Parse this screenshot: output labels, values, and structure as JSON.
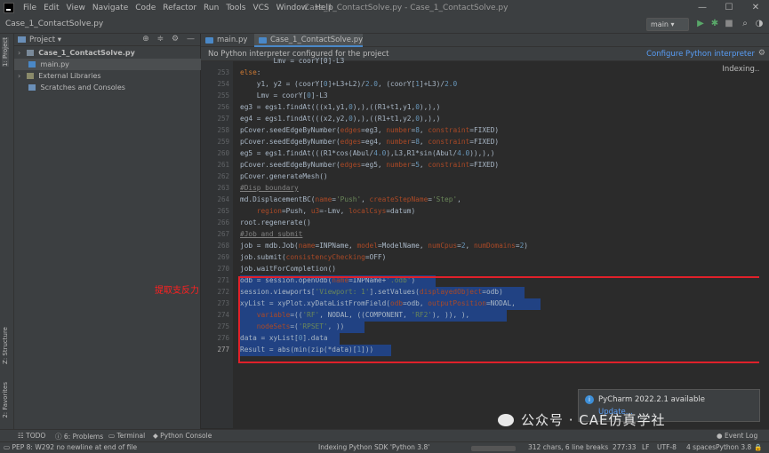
{
  "menubar": {
    "items": [
      "File",
      "Edit",
      "View",
      "Navigate",
      "Code",
      "Refactor",
      "Run",
      "Tools",
      "VCS",
      "Window",
      "Help"
    ],
    "window_title": "Case_1_ContactSolve.py - Case_1_ContactSolve.py",
    "minimize": "—",
    "maximize": "☐",
    "close": "✕"
  },
  "navbar": {
    "breadcrumb": "Case_1_ContactSolve.py",
    "branch": "main ▾"
  },
  "left_stripe": {
    "project_tab": "1: Project",
    "structure_tab": "Z: Structure",
    "favorites_tab": "2: Favorites"
  },
  "project_panel": {
    "title": "Project ▾",
    "tree": [
      {
        "label": "Case_1_ContactSolve.py",
        "bold": true
      },
      {
        "label": "main.py",
        "bold": false
      },
      {
        "label": "External Libraries",
        "bold": false
      },
      {
        "label": "Scratches and Consoles",
        "bold": false
      }
    ]
  },
  "tabs": [
    {
      "label": "main.py",
      "close": "×"
    },
    {
      "label": "Case_1_ContactSolve.py",
      "close": "×"
    }
  ],
  "banner": {
    "text": "No Python interpreter configured for the project",
    "link": "Configure Python interpreter"
  },
  "editor": {
    "indexing": "Indexing...",
    "annotation": "提取支反力",
    "current_line": "277",
    "top_fragment": "        Lmv = coorY[0]-L3",
    "lines": [
      {
        "num": "253",
        "text": "else:"
      },
      {
        "num": "254",
        "text": "    y1, y2 = (coorY[0]+L3+L2)/2.0, (coorY[1]+L3)/2.0"
      },
      {
        "num": "255",
        "text": "    Lmv = coorY[0]-L3"
      },
      {
        "num": "256",
        "text": "eg3 = egs1.findAt(((x1,y1,0),),((R1+t1,y1,0),),)"
      },
      {
        "num": "257",
        "text": "eg4 = egs1.findAt(((x2,y2,0),),((R1+t1,y2,0),),)"
      },
      {
        "num": "258",
        "text": "pCover.seedEdgeByNumber(edges=eg3, number=8, constraint=FIXED)"
      },
      {
        "num": "259",
        "text": "pCover.seedEdgeByNumber(edges=eg4, number=8, constraint=FIXED)"
      },
      {
        "num": "260",
        "text": "eg5 = egs1.findAt(((R1*cos(Abul/4.0),L3,R1*sin(Abul/4.0)),),)"
      },
      {
        "num": "261",
        "text": "pCover.seedEdgeByNumber(edges=eg5, number=5, constraint=FIXED)"
      },
      {
        "num": "262",
        "text": "pCover.generateMesh()"
      },
      {
        "num": "263",
        "text": "#Disp boundary"
      },
      {
        "num": "264",
        "text": "md.DisplacementBC(name='Push', createStepName='Step',"
      },
      {
        "num": "265",
        "text": "    region=Push, u3=-Lmv, localCsys=datum)"
      },
      {
        "num": "266",
        "text": "root.regenerate()"
      },
      {
        "num": "267",
        "text": "#Job and submit"
      },
      {
        "num": "268",
        "text": "job = mdb.Job(name=INPName, model=ModelName, numCpus=2, numDomains=2)"
      },
      {
        "num": "269",
        "text": "job.submit(consistencyChecking=OFF)"
      },
      {
        "num": "270",
        "text": "job.waitForCompletion()"
      },
      {
        "num": "271",
        "text": "odb = session.openOdb(name=INPName+'.odb')"
      },
      {
        "num": "272",
        "text": "session.viewports['Viewport: 1'].setValues(displayedObject=odb)"
      },
      {
        "num": "273",
        "text": "xyList = xyPlot.xyDataListFromField(odb=odb, outputPosition=NODAL,"
      },
      {
        "num": "274",
        "text": "    variable=(('RF', NODAL, ((COMPONENT, 'RF2'), )), ),"
      },
      {
        "num": "275",
        "text": "    nodeSets=('RPSET', ))"
      },
      {
        "num": "276",
        "text": "data = xyList[0].data"
      },
      {
        "num": "277",
        "text": "Result = abs(min(zip(*data)[1]))"
      }
    ]
  },
  "notification": {
    "title": "PyCharm 2022.2.1 available",
    "link": "Update..."
  },
  "watermark": "公众号 · CAE仿真学社",
  "tool_windows": {
    "todo": "TODO",
    "problems": "6: Problems",
    "terminal": "Terminal",
    "python_console": "Python Console",
    "event_log": "Event Log"
  },
  "status": {
    "message": "PEP 8: W292 no newline at end of file",
    "indexing": "Indexing Python SDK 'Python 3.8'",
    "chars": "312 chars, 6 line breaks",
    "position": "277:33",
    "line_sep": "LF",
    "encoding": "UTF-8",
    "indent": "4 spaces",
    "interpreter": "Python 3.8"
  },
  "colors": {
    "accent": "#4a88c7",
    "selection": "#214283",
    "highlight_box": "#e0202a",
    "annotation": "#ff2020"
  }
}
